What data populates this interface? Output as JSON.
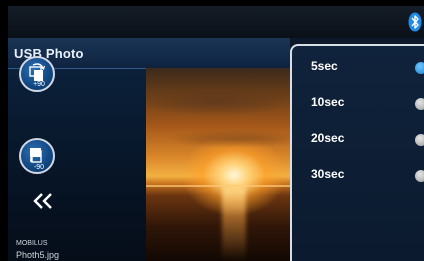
{
  "header": {
    "title": "USB Photo",
    "bluetooth_icon": "bluetooth-icon"
  },
  "controls": {
    "rotate_cw_label": "+90",
    "rotate_ccw_label": "-90",
    "back_icon": "double-chevron-left-icon"
  },
  "media": {
    "source": "MOBILUS",
    "filename": "Photh5.jpg"
  },
  "slideshow_interval": {
    "options": [
      {
        "label": "5sec",
        "selected": true
      },
      {
        "label": "10sec",
        "selected": false
      },
      {
        "label": "20sec",
        "selected": false
      },
      {
        "label": "30sec",
        "selected": false
      }
    ]
  },
  "colors": {
    "accent": "#1a7fd1",
    "popup_border": "#d8dee6"
  }
}
